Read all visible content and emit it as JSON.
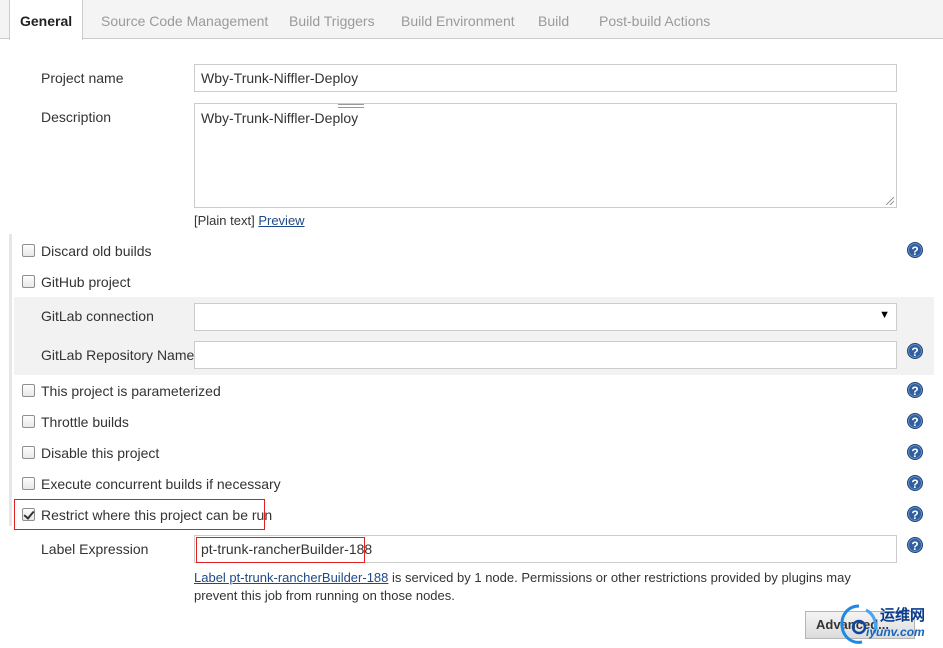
{
  "tabs": [
    {
      "label": "General"
    },
    {
      "label": "Source Code Management"
    },
    {
      "label": "Build Triggers"
    },
    {
      "label": "Build Environment"
    },
    {
      "label": "Build"
    },
    {
      "label": "Post-build Actions"
    }
  ],
  "project_name": {
    "label": "Project name",
    "value": "Wby-Trunk-Niffler-Deploy"
  },
  "description": {
    "label": "Description",
    "value": "Wby-Trunk-Niffler-Deploy",
    "format_label": "[Plain text]",
    "preview_link": "Preview"
  },
  "options": {
    "discard_old_builds": {
      "label": "Discard old builds",
      "checked": false
    },
    "github_project": {
      "label": "GitHub project",
      "checked": false
    },
    "parameterized": {
      "label": "This project is parameterized",
      "checked": false
    },
    "throttle": {
      "label": "Throttle builds",
      "checked": false
    },
    "disable": {
      "label": "Disable this project",
      "checked": false
    },
    "concurrent": {
      "label": "Execute concurrent builds if necessary",
      "checked": false
    },
    "restrict": {
      "label": "Restrict where this project can be run",
      "checked": true
    }
  },
  "gitlab": {
    "connection_label": "GitLab connection",
    "connection_value": "",
    "repo_label": "GitLab Repository Name",
    "repo_value": ""
  },
  "label_expression": {
    "label": "Label Expression",
    "value": "pt-trunk-rancherBuilder-188",
    "info_link": "Label pt-trunk-rancherBuilder-188",
    "info_text": " is serviced by 1 node. Permissions or other restrictions provided by plugins may prevent this job from running on those nodes."
  },
  "advanced_button": "Advanced...",
  "help_glyph": "?",
  "watermark": {
    "line1": "运维网",
    "line2": "iyunv.com"
  },
  "colors": {
    "link": "#204a87",
    "help": "#2f5f9e",
    "highlight": "#e02020"
  }
}
